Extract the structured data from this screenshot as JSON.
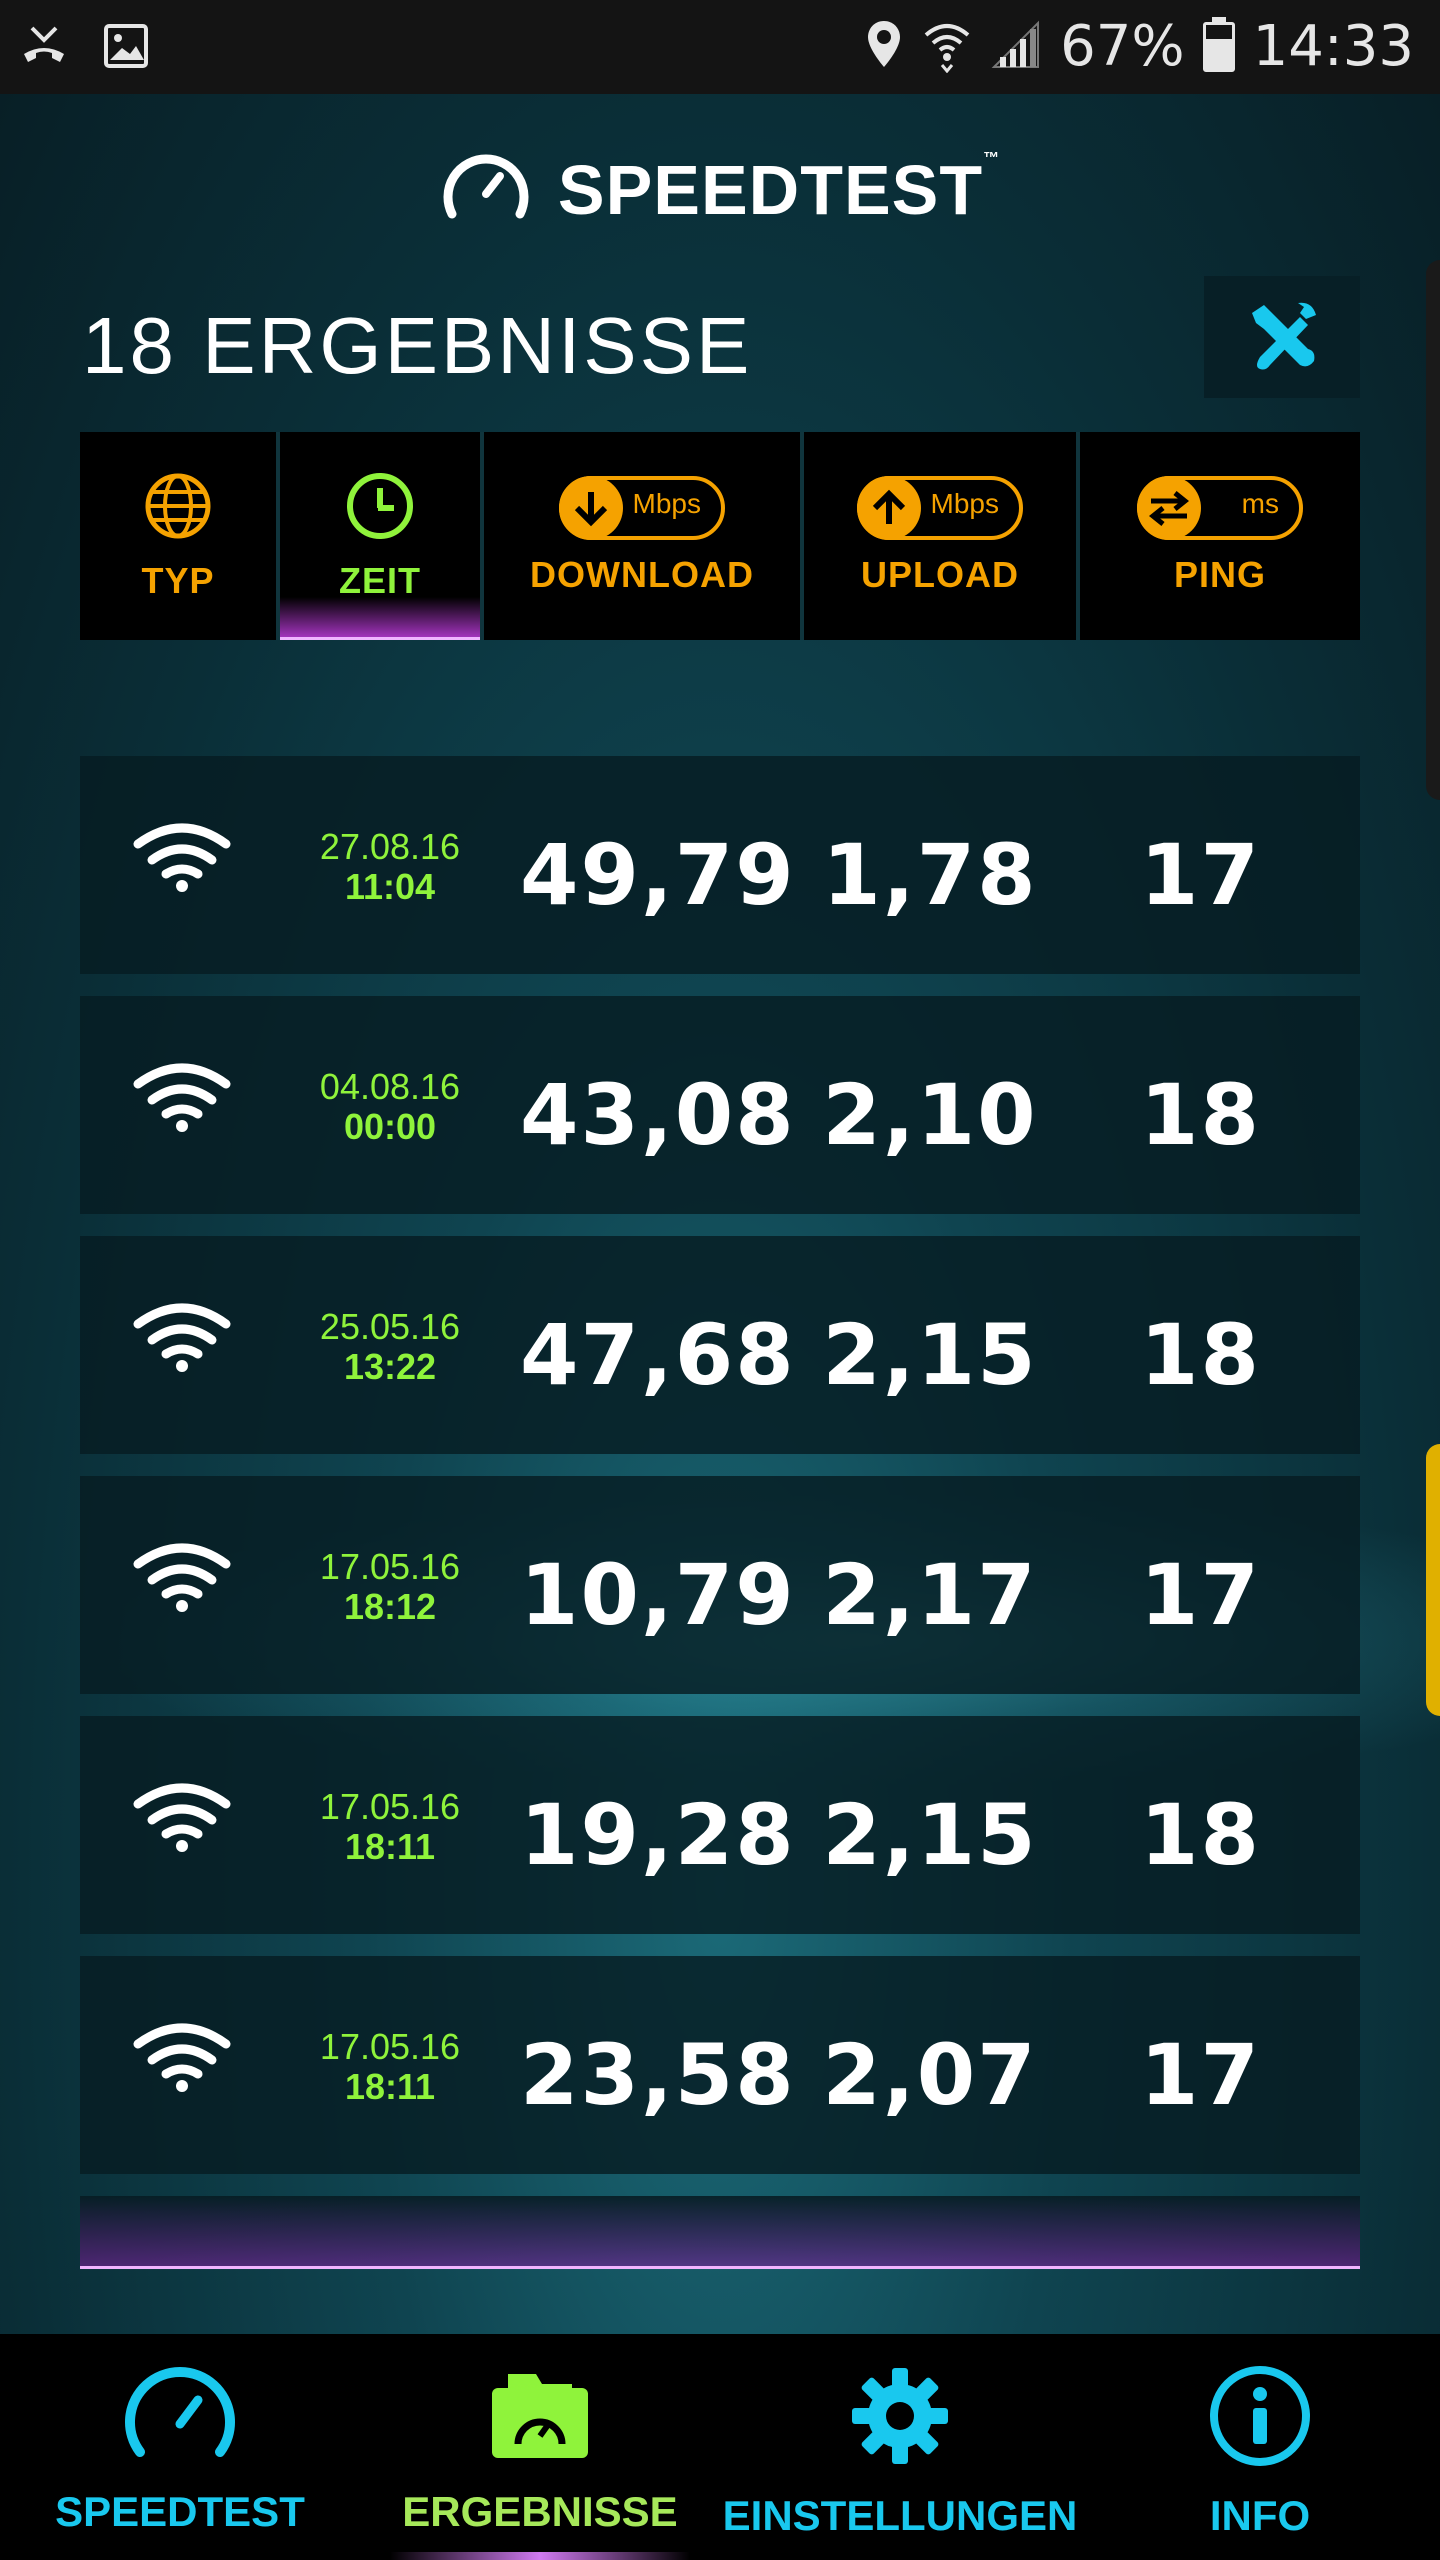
{
  "status_bar": {
    "battery": "67%",
    "battery_level": 0.67,
    "clock": "14:33"
  },
  "header": {
    "title": "SPEEDTEST",
    "trademark": "™"
  },
  "results": {
    "count_label": "18 ERGEBNISSE"
  },
  "columns": [
    {
      "label": "TYP",
      "icon": "globe-icon"
    },
    {
      "label": "ZEIT",
      "icon": "clock-icon",
      "active": true
    },
    {
      "label": "DOWNLOAD",
      "icon": "download-arrow-icon",
      "unit": "Mbps"
    },
    {
      "label": "UPLOAD",
      "icon": "upload-arrow-icon",
      "unit": "Mbps"
    },
    {
      "label": "PING",
      "icon": "ping-arrows-icon",
      "unit": "ms"
    }
  ],
  "rows": [
    {
      "type": "wifi-icon",
      "date": "27.08.16",
      "time": "11:04",
      "download": "49,79",
      "upload": "1,78",
      "ping": "17"
    },
    {
      "type": "wifi-icon",
      "date": "04.08.16",
      "time": "00:00",
      "download": "43,08",
      "upload": "2,10",
      "ping": "18"
    },
    {
      "type": "wifi-icon",
      "date": "25.05.16",
      "time": "13:22",
      "download": "47,68",
      "upload": "2,15",
      "ping": "18"
    },
    {
      "type": "wifi-icon",
      "date": "17.05.16",
      "time": "18:12",
      "download": "10,79",
      "upload": "2,17",
      "ping": "17"
    },
    {
      "type": "wifi-icon",
      "date": "17.05.16",
      "time": "18:11",
      "download": "19,28",
      "upload": "2,15",
      "ping": "18"
    },
    {
      "type": "wifi-icon",
      "date": "17.05.16",
      "time": "18:11",
      "download": "23,58",
      "upload": "2,07",
      "ping": "17"
    }
  ],
  "nav": [
    {
      "label": "SPEEDTEST",
      "icon": "speedometer-icon"
    },
    {
      "label": "ERGEBNISSE",
      "icon": "results-folder-icon",
      "active": true
    },
    {
      "label": "EINSTELLUNGEN",
      "icon": "gear-icon"
    },
    {
      "label": "INFO",
      "icon": "info-icon"
    }
  ],
  "colors": {
    "accent_orange": "#f5a200",
    "accent_green": "#8ff33b",
    "accent_cyan": "#19c8ee",
    "accent_purple": "#d07af0"
  }
}
